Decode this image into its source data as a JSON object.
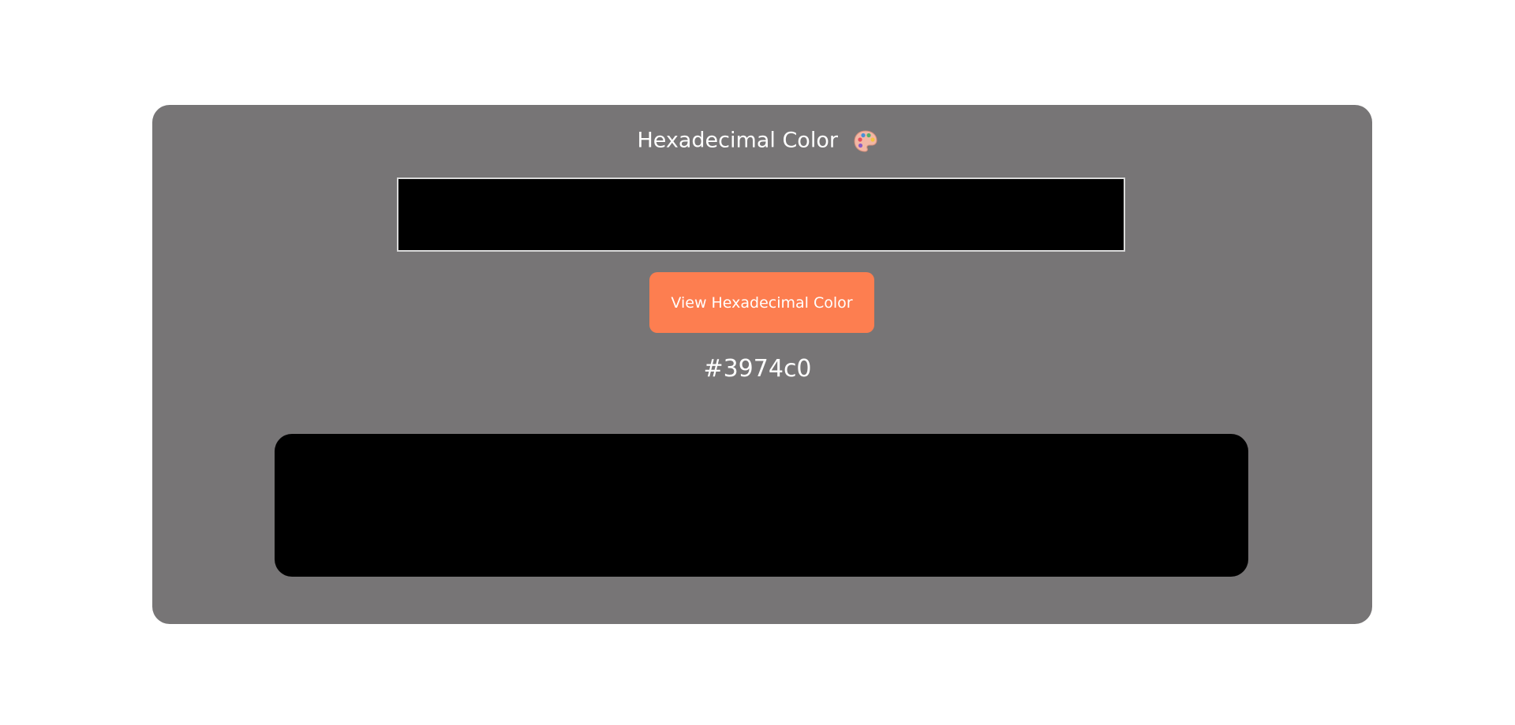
{
  "app": {
    "title": "Hexadecimal Color",
    "title_icon": "palette-icon"
  },
  "input": {
    "value": "",
    "placeholder": "",
    "background": "#000000"
  },
  "button": {
    "label": "View Hexadecimal Color",
    "color": "#fd7e50"
  },
  "result": {
    "hex_value": "#3974c0"
  },
  "preview": {
    "color": "#000000"
  },
  "colors": {
    "card_background": "#777576",
    "page_background": "#ffffff",
    "text": "#ffffff"
  }
}
